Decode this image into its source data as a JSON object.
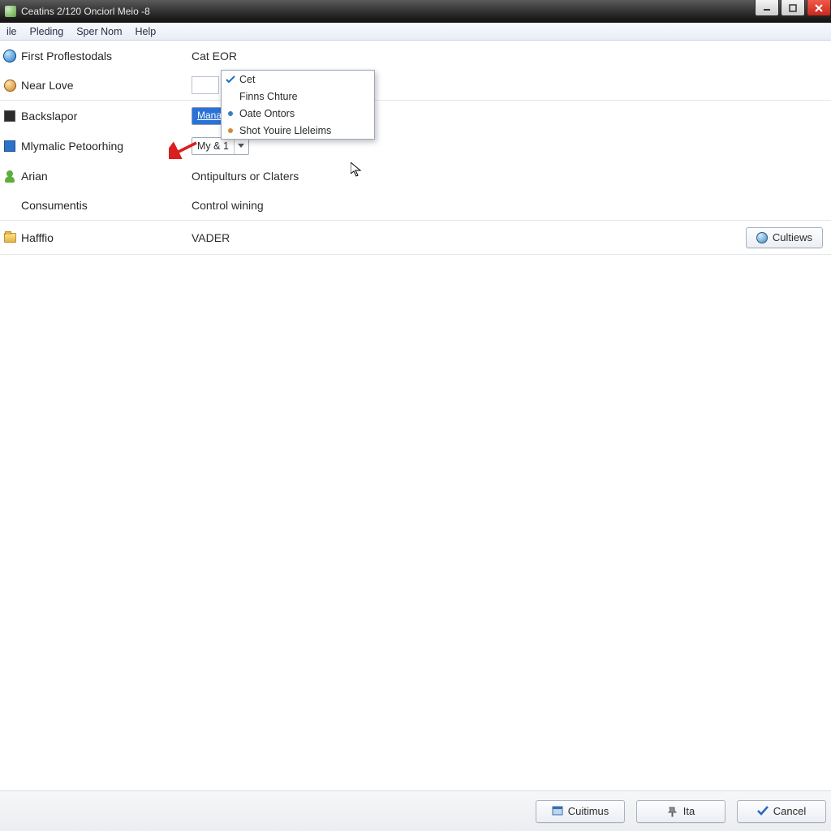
{
  "window": {
    "title": "Ceatins 2/120 Onciorl Meio -8"
  },
  "menubar": {
    "items": [
      "ile",
      "Pleding",
      "Sper Nom",
      "Help"
    ]
  },
  "rows": [
    {
      "label": "First Proflestodals",
      "value": "Cat EOR",
      "icon": "circle-blue"
    },
    {
      "label": "Near Love",
      "value": "",
      "icon": "orb-orange"
    },
    {
      "label": "Backslapor",
      "value": "",
      "icon": "sq-dark",
      "selected_token": "Mana"
    },
    {
      "label": "Mlymalic Petoorhing",
      "value": "",
      "icon": "sq-blue",
      "combo": "My & 1"
    },
    {
      "label": "Arian",
      "value": "Ontipulturs or Claters",
      "icon": "person"
    },
    {
      "label": "Consumentis",
      "value": "Control wining",
      "icon": "none"
    },
    {
      "label": "Hafffio",
      "value": "VADER",
      "icon": "folder",
      "right_button": "Cultiews"
    }
  ],
  "dropdown": {
    "items": [
      {
        "label": "Cet",
        "mark": "check-blue"
      },
      {
        "label": "Finns Chture",
        "mark": ""
      },
      {
        "label": "Oate Ontors",
        "mark": "dot-blue"
      },
      {
        "label": "Shot Youire Lleleims",
        "mark": "dot-orange"
      }
    ]
  },
  "footer": {
    "buttons": [
      {
        "label": "Cuitimus",
        "icon": "win-icon"
      },
      {
        "label": "Ita",
        "icon": "pin-icon"
      },
      {
        "label": "Cancel",
        "icon": "check-icon"
      }
    ]
  }
}
